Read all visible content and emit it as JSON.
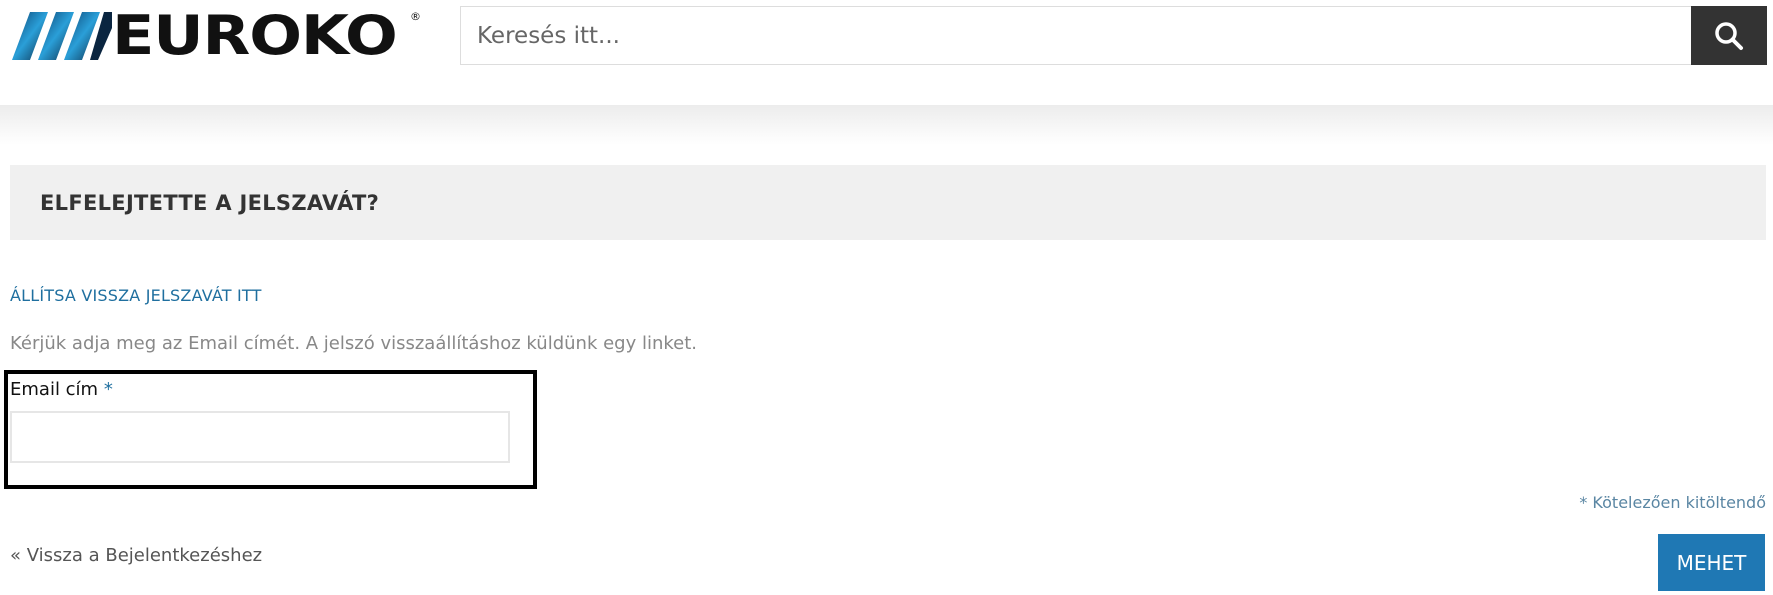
{
  "header": {
    "logo_text": "EUROKO",
    "logo_reg_mark": "®",
    "search": {
      "placeholder": "Keresés itt...",
      "value": "",
      "button_icon": "search-icon"
    }
  },
  "title_bar": {
    "title": "ELFELEJTETTE A JELSZAVÁT?"
  },
  "form": {
    "section_title": "ÁLLÍTSA VISSZA JELSZAVÁT ITT",
    "description": "Kérjük adja meg az Email címét. A jelszó visszaállításhoz küldünk egy linket.",
    "email_label": "Email cím",
    "required_marker": "*",
    "email_value": "",
    "required_note": "* Kötelezően kitöltendő",
    "back_link": "« Vissza a Bejelentkezéshez",
    "submit_label": "MEHET"
  },
  "colors": {
    "accent_blue": "#1f78b4",
    "search_button_bg": "#333333",
    "title_bar_bg": "#f0f0f0",
    "highlight_border": "#000000"
  }
}
